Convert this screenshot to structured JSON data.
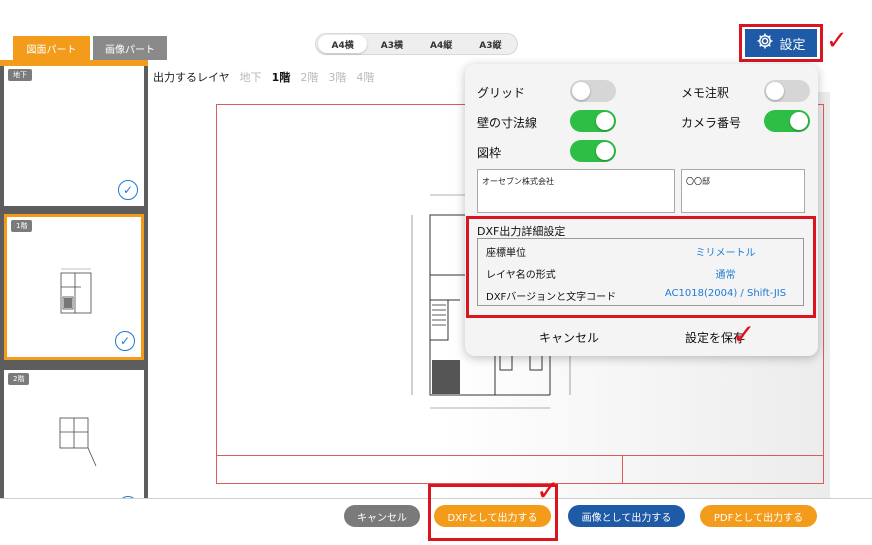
{
  "tabs": [
    "図面パート",
    "画像パート"
  ],
  "paper_sizes": [
    "A4横",
    "A3横",
    "A4縦",
    "A3縦"
  ],
  "settings_button": "設定",
  "layer_bar": {
    "label": "出力するレイヤ",
    "layers": [
      "地下",
      "1階",
      "2階",
      "3階",
      "4階"
    ],
    "active": "1階"
  },
  "thumbnails": [
    {
      "label": "地下",
      "checked": true
    },
    {
      "label": "1階",
      "checked": true,
      "selected": true
    },
    {
      "label": "2階",
      "checked": true
    }
  ],
  "settings_panel": {
    "options": [
      {
        "label": "グリッド",
        "state": "off"
      },
      {
        "label": "メモ注釈",
        "state": "off"
      },
      {
        "label": "壁の寸法線",
        "state": "on"
      },
      {
        "label": "カメラ番号",
        "state": "on"
      },
      {
        "label": "図枠",
        "state": "on"
      }
    ],
    "company_field": "オーセブン株式会社",
    "owner_field": "〇〇邸",
    "dxf_title": "DXF出力詳細設定",
    "dxf_rows": [
      {
        "key": "座標単位",
        "value": "ミリメートル"
      },
      {
        "key": "レイヤ名の形式",
        "value": "通常"
      },
      {
        "key": "DXFバージョンと文字コード",
        "value": "AC1018(2004) / Shift-JIS"
      }
    ],
    "cancel": "キャンセル",
    "save": "設定を保存"
  },
  "bottom_buttons": {
    "cancel": "キャンセル",
    "dxf": "DXFとして出力する",
    "image": "画像として出力する",
    "pdf": "PDFとして出力する"
  },
  "colors": {
    "accent_orange": "#f39c1b",
    "accent_blue": "#1f5aa6",
    "toggle_on": "#2ebd45",
    "annotation_red": "#d9161f",
    "link_blue": "#1e7bd6"
  }
}
